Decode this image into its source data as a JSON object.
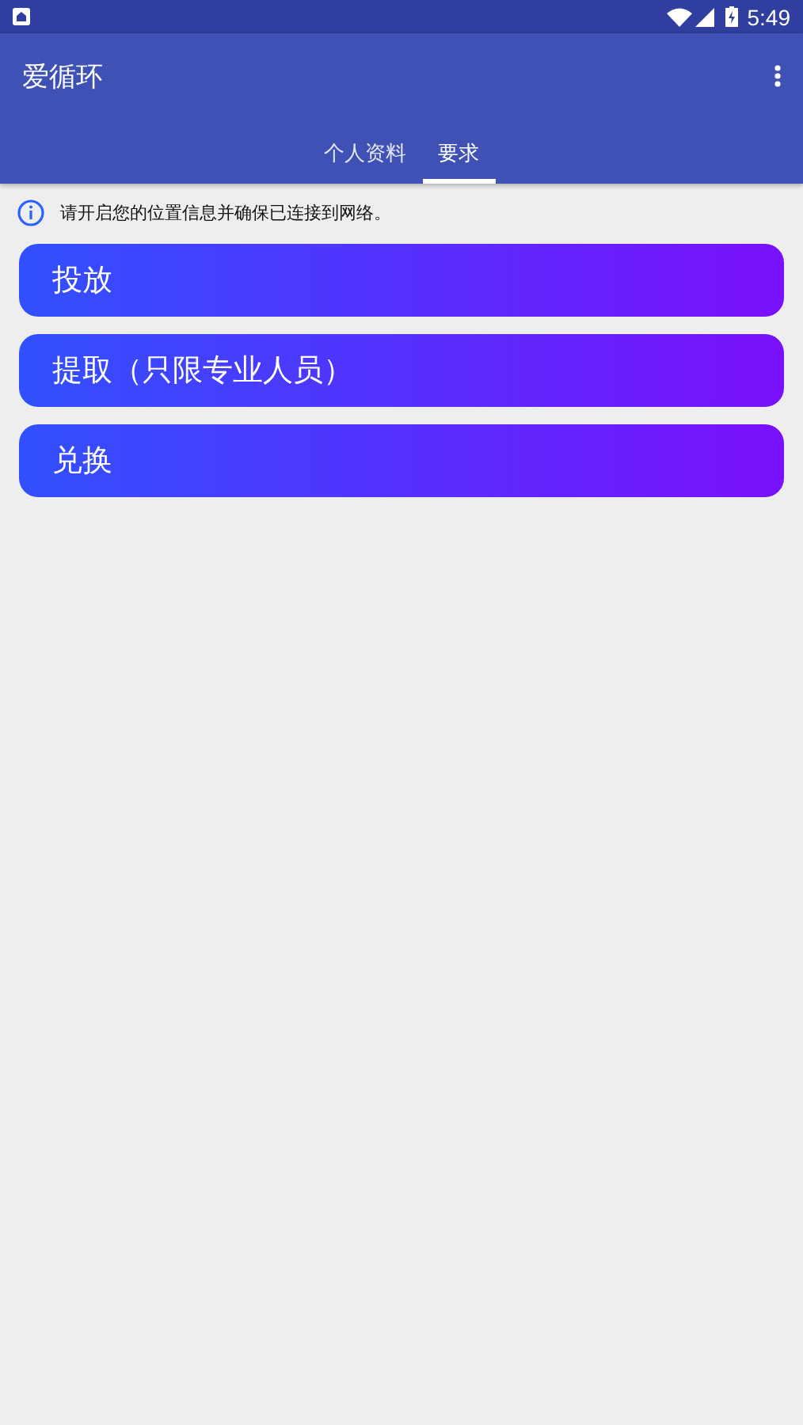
{
  "status_bar": {
    "time": "5:49"
  },
  "app_bar": {
    "title": "爱循环"
  },
  "tabs": [
    {
      "label": "个人资料",
      "selected": false
    },
    {
      "label": "要求",
      "selected": true
    }
  ],
  "notice": {
    "text": "请开启您的位置信息并确保已连接到网络。"
  },
  "actions": [
    {
      "label": "投放"
    },
    {
      "label": "提取（只限专业人员）"
    },
    {
      "label": "兑换"
    }
  ]
}
